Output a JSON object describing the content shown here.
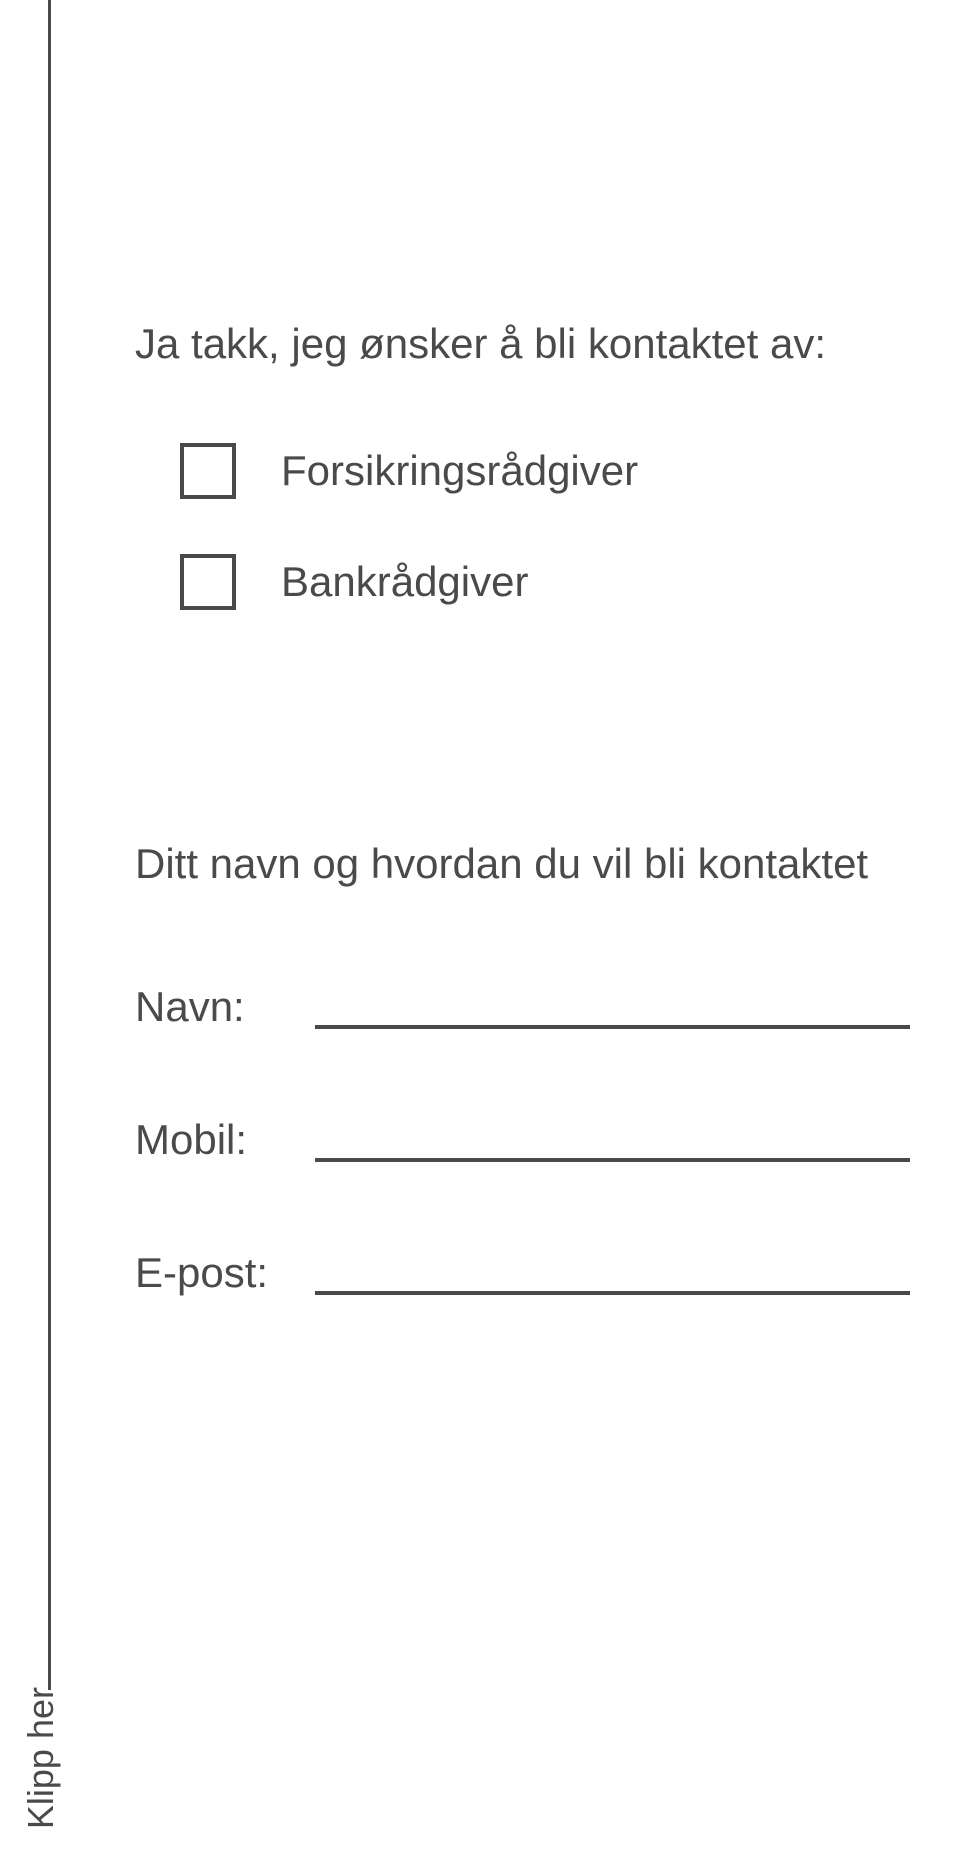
{
  "cutLabel": "Klipp her",
  "heading": "Ja takk, jeg ønsker å bli kontaktet av:",
  "options": {
    "option1": "Forsikringsrådgiver",
    "option2": "Bankrådgiver"
  },
  "subheading": "Ditt navn og hvordan du vil bli kontaktet",
  "fields": {
    "name": "Navn:",
    "mobile": "Mobil:",
    "email": "E-post:"
  }
}
